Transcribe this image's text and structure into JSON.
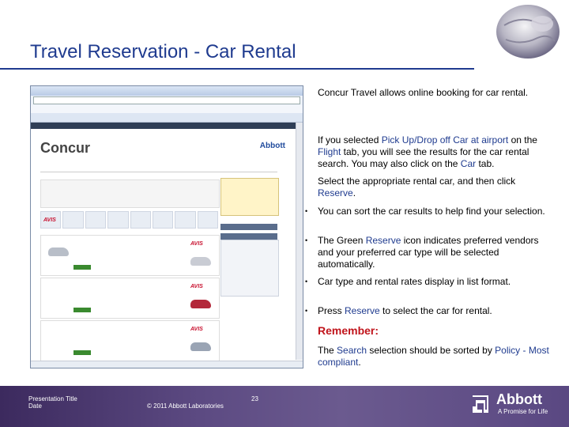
{
  "slide": {
    "title": "Travel Reservation - Car Rental"
  },
  "content": {
    "p1": "Concur Travel allows online booking for car rental.",
    "p2": {
      "a": "If you selected ",
      "b": "Pick Up/Drop off Car at airport",
      "c": " on the ",
      "d": "Flight",
      "e": " tab, you will see the results for the car rental search. You may also click on the ",
      "f": "Car",
      "g": " tab."
    },
    "p3": {
      "a": "Select the appropriate rental car, and then click ",
      "b": "Reserve",
      "c": "."
    },
    "bullets": [
      {
        "a": "You can sort the car results to help find your selection."
      },
      {
        "a": "The Green ",
        "b": "Reserve",
        "c": " icon indicates preferred vendors and your preferred car type will be selected automatically."
      },
      {
        "a": "Car type and rental rates display in list format."
      },
      {
        "a": "Press ",
        "b": "Reserve",
        "c": " to select the car for rental."
      }
    ],
    "remember_label": "Remember:",
    "p4": {
      "a": "The ",
      "b": "Search",
      "c": " selection should be sorted by ",
      "d": "Policy - Most compliant",
      "e": "."
    }
  },
  "screenshot": {
    "logo": "Concur",
    "partner": "Abbott"
  },
  "footer": {
    "presentation_title": "Presentation Title",
    "date": "Date",
    "copyright": "© 2011 Abbott Laboratories",
    "page": "23",
    "brand": "Abbott",
    "tagline": "A Promise for Life"
  },
  "colors": {
    "title": "#1f3b8f",
    "highlight": "#1f3b8f",
    "remember": "#c0141b",
    "footer": "#5c4a82"
  }
}
